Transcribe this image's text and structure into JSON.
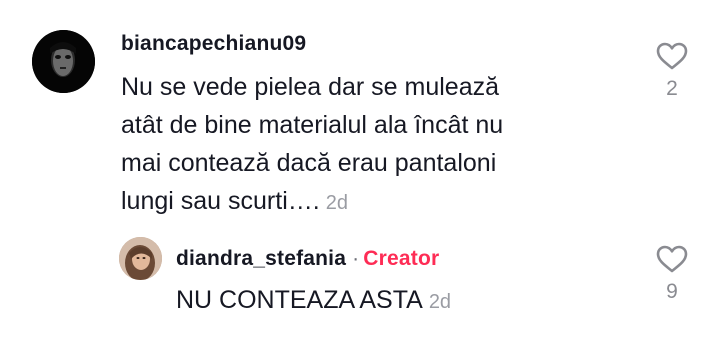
{
  "comment": {
    "username": "biancapechianu09",
    "text_lines": [
      "Nu se vede pielea dar se mulează",
      "atât de bine materialul ala încât nu",
      "mai contează dacă erau pantaloni",
      "lungi sau scurti…."
    ],
    "time": "2d",
    "like_count": "2",
    "like_icon": "heart-outline-icon"
  },
  "reply": {
    "username": "diandra_stefania",
    "separator": "·",
    "badge": "Creator",
    "text": "NU CONTEAZA ASTA",
    "time": "2d",
    "like_count": "9",
    "like_icon": "heart-outline-icon",
    "badge_color": "#fe2c55"
  },
  "colors": {
    "text": "#161823",
    "secondary": "#9a9ca3",
    "accent": "#fe2c55"
  }
}
